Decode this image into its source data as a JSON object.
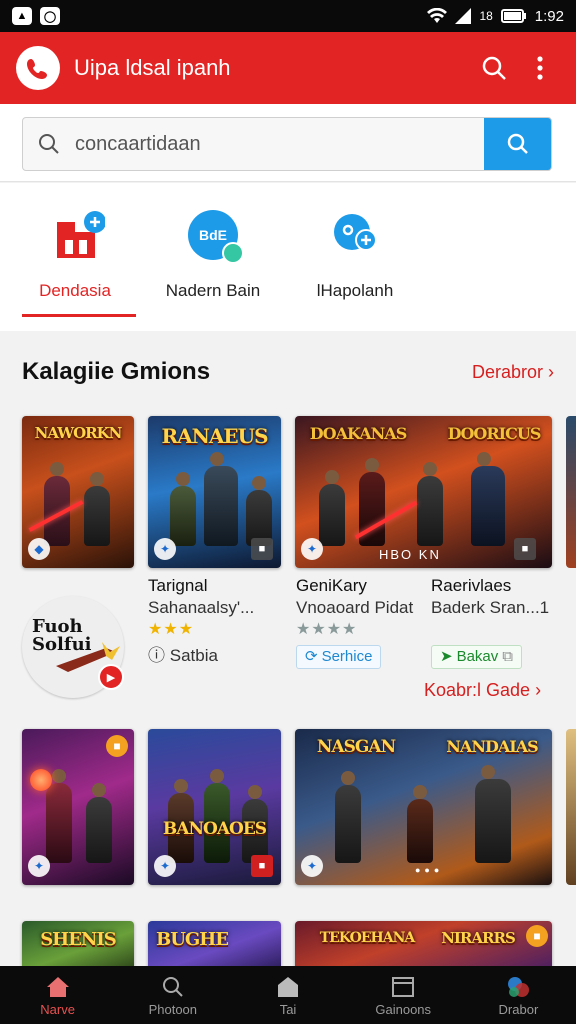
{
  "status": {
    "time": "1:92",
    "left_icons": [
      "notification-icon",
      "whatsapp-icon"
    ],
    "battery": "18"
  },
  "appbar": {
    "title": "Uipa ldsal ipanh",
    "bg": "#e32424"
  },
  "search": {
    "value": "concaartidaan"
  },
  "tabs": [
    {
      "label": "Dendasia",
      "active": true
    },
    {
      "label": "Nadern Bain",
      "active": false,
      "icon_text": "BdE"
    },
    {
      "label": "lHapolanh",
      "active": false
    }
  ],
  "section": {
    "title": "Kalagiie Gmions",
    "link": "Derabror"
  },
  "row1": [
    {
      "art_title": "NAWORKN",
      "name": "Tarignal",
      "sub": "Sahanaalsy'...",
      "extra": "Satbia",
      "rating": 3
    },
    {
      "art_title": "RANAEUS",
      "name": "GeniKary",
      "sub": "Vnoaoard Pidat",
      "rating": 4,
      "pill": "Serhice"
    },
    {
      "art_title_a": "DOAKANAS",
      "art_title_b": "DOORICUS",
      "art_caption": "HBO KN",
      "name": "Raerivlaes",
      "sub": "Baderk Sran...1",
      "pill": "Bakav"
    }
  ],
  "promo": {
    "text": "Fuoh Solfui"
  },
  "more_link": "Koabr:l Gade",
  "row2": [
    {
      "art_title": ""
    },
    {
      "art_title": "BANOAOES"
    },
    {
      "art_title_a": "NASGAN",
      "art_title_b": "NANDAIAS"
    }
  ],
  "row3": [
    {
      "art_title": "SHENIS"
    },
    {
      "art_title": "BUGHE"
    },
    {
      "art_title_a": "TEKOEHANA",
      "art_title_b": "NIRARRS"
    }
  ],
  "nav": [
    {
      "label": "Narve",
      "active": true
    },
    {
      "label": "Photoon",
      "active": false
    },
    {
      "label": "Tai",
      "active": false
    },
    {
      "label": "Gainoons",
      "active": false
    },
    {
      "label": "Drabor",
      "active": false
    }
  ]
}
